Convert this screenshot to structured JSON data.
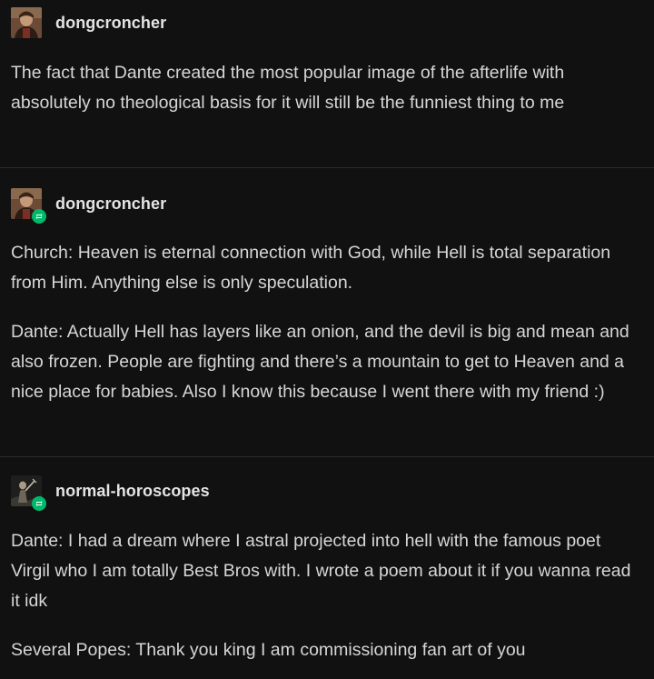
{
  "posts": [
    {
      "username": "dongcroncher",
      "reblog": false,
      "paragraphs": [
        "The fact that Dante created the most popular image of the afterlife with absolutely no theological basis for it will still be the funniest thing to me"
      ]
    },
    {
      "username": "dongcroncher",
      "reblog": true,
      "paragraphs": [
        "Church: Heaven is eternal connection with God, while Hell is total separation from Him. Anything else is only speculation.",
        "Dante: Actually Hell has layers like an onion, and the devil is big and mean and also frozen. People are fighting and there’s a mountain to get to Heaven and a nice place for babies. Also I know this because I went there with my friend :)"
      ]
    },
    {
      "username": "normal-horoscopes",
      "reblog": true,
      "paragraphs": [
        "Dante: I had a dream where I astral projected into hell with the famous poet Virgil who I am totally Best Bros with. I wrote a poem about it if you wanna read it idk",
        "Several Popes: Thank you king I am commissioning fan art of you"
      ]
    }
  ],
  "colors": {
    "background": "#111112",
    "text": "#d6d6d6",
    "divider": "#2b2b2c",
    "reblog_badge": "#00b96a"
  },
  "icons": {
    "avatar_dongcroncher": "portrait-avatar-icon",
    "avatar_normal_horoscopes": "figure-avatar-icon",
    "reblog": "reblog-icon"
  }
}
